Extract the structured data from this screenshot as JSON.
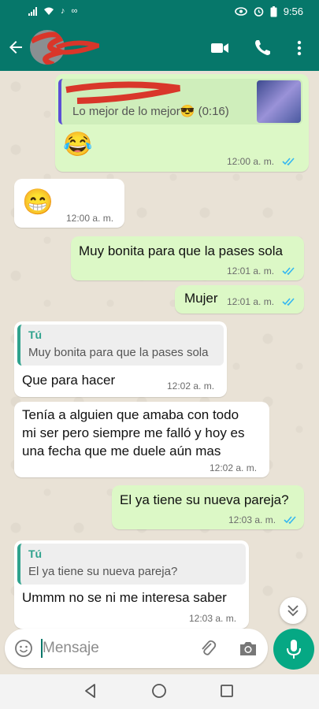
{
  "status_bar": {
    "time": "9:56"
  },
  "composer": {
    "placeholder": "Mensaje"
  },
  "messages": [
    {
      "direction": "outgoing",
      "reply_preview": "Lo mejor de lo mejor😎 (0:16)",
      "text": "😂",
      "time": "12:00 a. m.",
      "status": "read"
    },
    {
      "direction": "incoming",
      "text": "😁",
      "time": "12:00 a. m."
    },
    {
      "direction": "outgoing",
      "text": "Muy bonita para que la pases sola",
      "time": "12:01 a. m.",
      "status": "read"
    },
    {
      "direction": "outgoing",
      "text": "Mujer",
      "time": "12:01 a. m.",
      "status": "read"
    },
    {
      "direction": "incoming",
      "quote_author": "Tú",
      "quote_text": "Muy bonita para que la pases sola",
      "text": "Que para hacer",
      "time": "12:02 a. m."
    },
    {
      "direction": "incoming",
      "lines": [
        "Tenía a alguien que amaba con todo",
        "mi ser pero siempre me falló y hoy es",
        "una fecha que me duele aún mas"
      ],
      "time": "12:02 a. m."
    },
    {
      "direction": "outgoing",
      "text": "El ya tiene su nueva pareja?",
      "time": "12:03 a. m.",
      "status": "read"
    },
    {
      "direction": "incoming",
      "quote_author": "Tú",
      "quote_text": "El ya tiene su nueva pareja?",
      "text": "Ummm no se ni me interesa saber",
      "time": "12:03 a. m."
    }
  ],
  "colors": {
    "header": "#06776a",
    "outgoing_bubble": "#dcf8c6",
    "incoming_bubble": "#ffffff",
    "read_ticks": "#34b7f1",
    "mic_button": "#06a884",
    "quote_accent": "#2fa28d"
  },
  "icons": [
    "back-arrow-icon",
    "video-call-icon",
    "phone-icon",
    "more-options-icon",
    "emoji-icon",
    "attach-icon",
    "camera-icon",
    "mic-icon",
    "scroll-down-icon",
    "nav-back-icon",
    "nav-home-icon",
    "nav-recents-icon"
  ]
}
